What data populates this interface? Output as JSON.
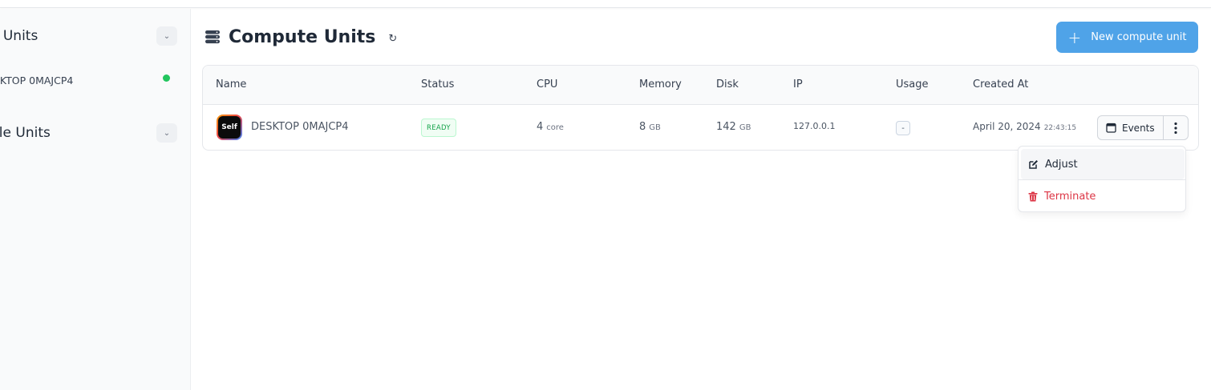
{
  "sidebar": {
    "section1": "e Units",
    "item1": "SKTOP 0MAJCP4",
    "item1_status_color": "#22c55e",
    "section2": "ble Units"
  },
  "header": {
    "title": "Compute Units",
    "refresh_icon": "refresh-icon",
    "new_button_label": "New compute unit",
    "new_button_color": "#4fa3e8"
  },
  "table": {
    "columns": [
      "Name",
      "Status",
      "CPU",
      "Memory",
      "Disk",
      "IP",
      "Usage",
      "Created At"
    ],
    "rows": [
      {
        "avatar_text": "Self",
        "name": "DESKTOP 0MAJCP4",
        "status": "READY",
        "cpu_value": "4",
        "cpu_unit": "core",
        "memory_value": "8",
        "memory_unit": "GB",
        "disk_value": "142",
        "disk_unit": "GB",
        "ip": "127.0.0.1",
        "usage": "-",
        "created_date": "April 20, 2024",
        "created_time": "22:43:15",
        "events_label": "Events"
      }
    ]
  },
  "menu": {
    "adjust": "Adjust",
    "terminate": "Terminate",
    "terminate_color": "#dc3545"
  }
}
